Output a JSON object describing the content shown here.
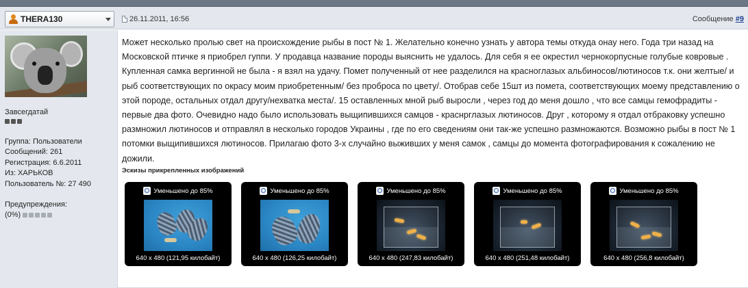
{
  "header": {
    "username": "THERA130",
    "date": "26.11.2011, 16:56",
    "post_label": "Сообщение",
    "post_number": "#9"
  },
  "sidebar": {
    "rank": "Завсегдатай",
    "group": "Группа: Пользователи",
    "messages": "Сообщений: 261",
    "registered": "Регистрация: 6.6.2011",
    "from": "Из: ХАРЬКОВ",
    "user_number": "Пользователь №: 27 490",
    "warnings_label": "Предупреждения:",
    "warnings_value": "(0%)",
    "rank_level": 3,
    "warning_level": 0
  },
  "post": {
    "text": "Может несколько пролью свет на происхождение рыбы в пост № 1. Желательно конечно узнать у автора темы откуда онау него. Года три назад на Московской птичке я приобрел гуппи. У продавца название породы выяснить не удалось. Для себя я ее окрестил чернокорпусные голубые ковровые . Купленная самка вергинной не была - я взял на удачу. Помет полученный от нее разделился на красноглазых альбиносов/лютиносов т.к. они желтые/ и рыб соответствующих по окрасу моим приобретенным/ без проброса по цвету/. Отобрав себе 15шт из помета, соответствующих моему представлению о этой породе, остальных отдал другу/нехватка места/. 15 оставленных мной рыб выросли , через год до меня дошло , что все самцы гемофрадиты - первые два фото. Очевидно надо было использовать выщипившихся самцов - краснрглазых лютиносов. Друг , которому я отдал отбраковку успешно размножил лютиносов и отправлял в несколько городов Украины , где по его сведениям они так-же успешно размножаются. Возможно рыбы в пост № 1 потомки выщипившихся лютиносов. Прилагаю фото 3-х случайно выживших у меня самок , самцы до момента фотографирования к сожалению не дожили."
  },
  "attachments": {
    "title": "Эскизы прикрепленных изображений",
    "items": [
      {
        "caption": "Уменьшено до 85%",
        "size": "640 x 480 (121,95 килобайт)"
      },
      {
        "caption": "Уменьшено до 85%",
        "size": "640 x 480 (126,25 килобайт)"
      },
      {
        "caption": "Уменьшено до 85%",
        "size": "640 x 480 (247,83 килобайт)"
      },
      {
        "caption": "Уменьшено до 85%",
        "size": "640 x 480 (251,48 килобайт)"
      },
      {
        "caption": "Уменьшено до 85%",
        "size": "640 x 480 (256,8 килобайт)"
      }
    ]
  },
  "colors": {
    "header_bg": "#e4e8ee",
    "topbar": "#6b7785",
    "link": "#1a3d8f",
    "user_icon": "#e08a1e"
  },
  "icons": [
    "user-icon",
    "chevron-down-icon",
    "document-icon",
    "magnifier-icon"
  ]
}
